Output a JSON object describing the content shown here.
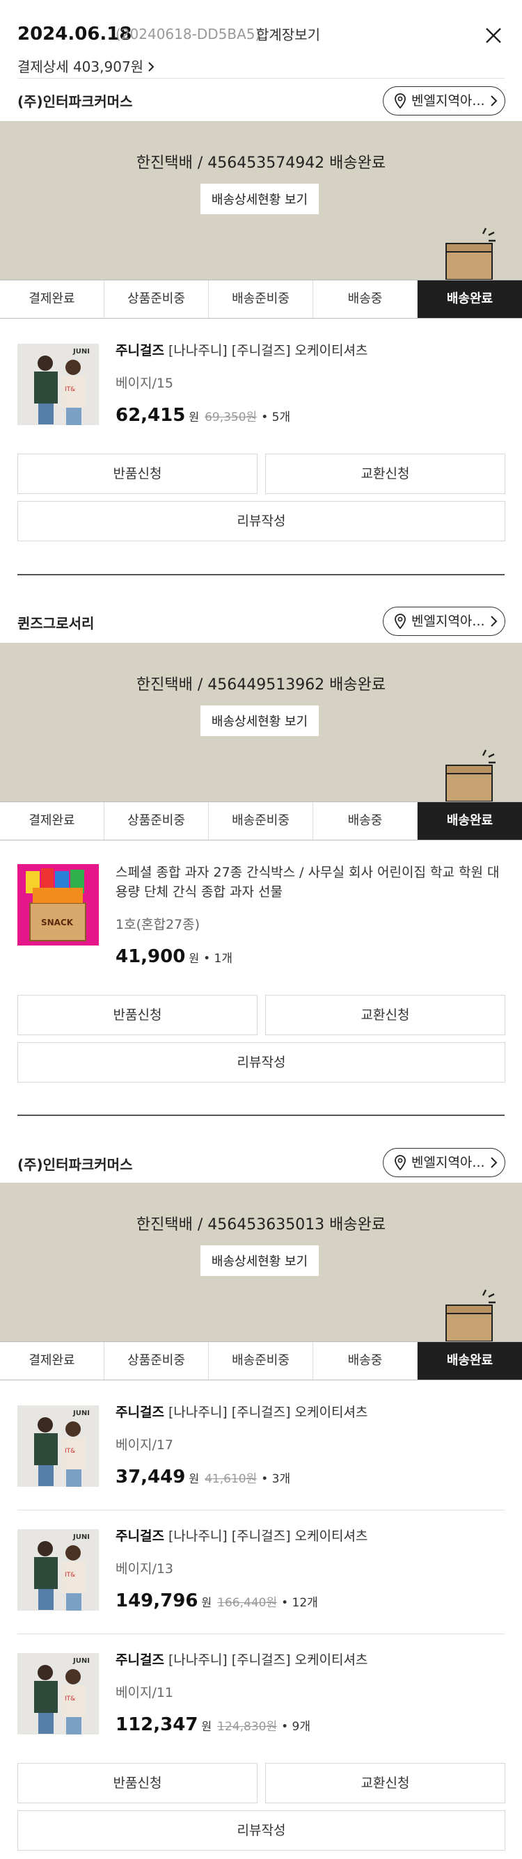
{
  "header": {
    "date": "2024.06.18",
    "order_code": "(20240618-DD5BA5)",
    "view_cart": "합계장보기",
    "payment": "결제상세 403,907원",
    "close_icon": "close-icon"
  },
  "steps": [
    "결제완료",
    "상품준비중",
    "배송준비중",
    "배송중",
    "배송완료"
  ],
  "shipments": [
    {
      "seller": "(주)인터파크커머스",
      "region": "벤엘지역아...",
      "tracking": "한진택배 / 456453574942 배송완료",
      "detail_btn": "배송상세현황 보기",
      "items": [
        {
          "brand": "주니걸즈",
          "name": " [나나주니] [주니걸즈] 오케이티셔츠",
          "option": "베이지/15",
          "price": "62,415",
          "won": "원",
          "orig": "69,350원",
          "qty": "• 5개"
        }
      ],
      "btn_return": "반품신청",
      "btn_exchange": "교환신청",
      "btn_review": "리뷰작성"
    },
    {
      "seller": "퀸즈그로서리",
      "region": "벤엘지역아...",
      "tracking": "한진택배 / 456449513962 배송완료",
      "detail_btn": "배송상세현황 보기",
      "items": [
        {
          "brand": "",
          "name": "스페셜 종합 과자 27종 간식박스 / 사무실 회사 어린이집 학교 학원 대용량 단체 간식 종합 과자 선물",
          "option": "1호(혼합27종)",
          "price": "41,900",
          "won": "원",
          "orig": "",
          "qty": "• 1개"
        }
      ],
      "btn_return": "반품신청",
      "btn_exchange": "교환신청",
      "btn_review": "리뷰작성"
    },
    {
      "seller": "(주)인터파크커머스",
      "region": "벤엘지역아...",
      "tracking": "한진택배 / 456453635013 배송완료",
      "detail_btn": "배송상세현황 보기",
      "items": [
        {
          "brand": "주니걸즈",
          "name": " [나나주니] [주니걸즈] 오케이티셔츠",
          "option": "베이지/17",
          "price": "37,449",
          "won": "원",
          "orig": "41,610원",
          "qty": "• 3개"
        },
        {
          "brand": "주니걸즈",
          "name": " [나나주니] [주니걸즈] 오케이티셔츠",
          "option": "베이지/13",
          "price": "149,796",
          "won": "원",
          "orig": "166,440원",
          "qty": "• 12개"
        },
        {
          "brand": "주니걸즈",
          "name": " [나나주니] [주니걸즈] 오케이티셔츠",
          "option": "베이지/11",
          "price": "112,347",
          "won": "원",
          "orig": "124,830원",
          "qty": "• 9개"
        }
      ],
      "btn_return": "반품신청",
      "btn_exchange": "교환신청",
      "btn_review": "리뷰작성"
    }
  ],
  "colors": {
    "banner": "#d6d2c3",
    "active_step": "#1f1f1f"
  }
}
